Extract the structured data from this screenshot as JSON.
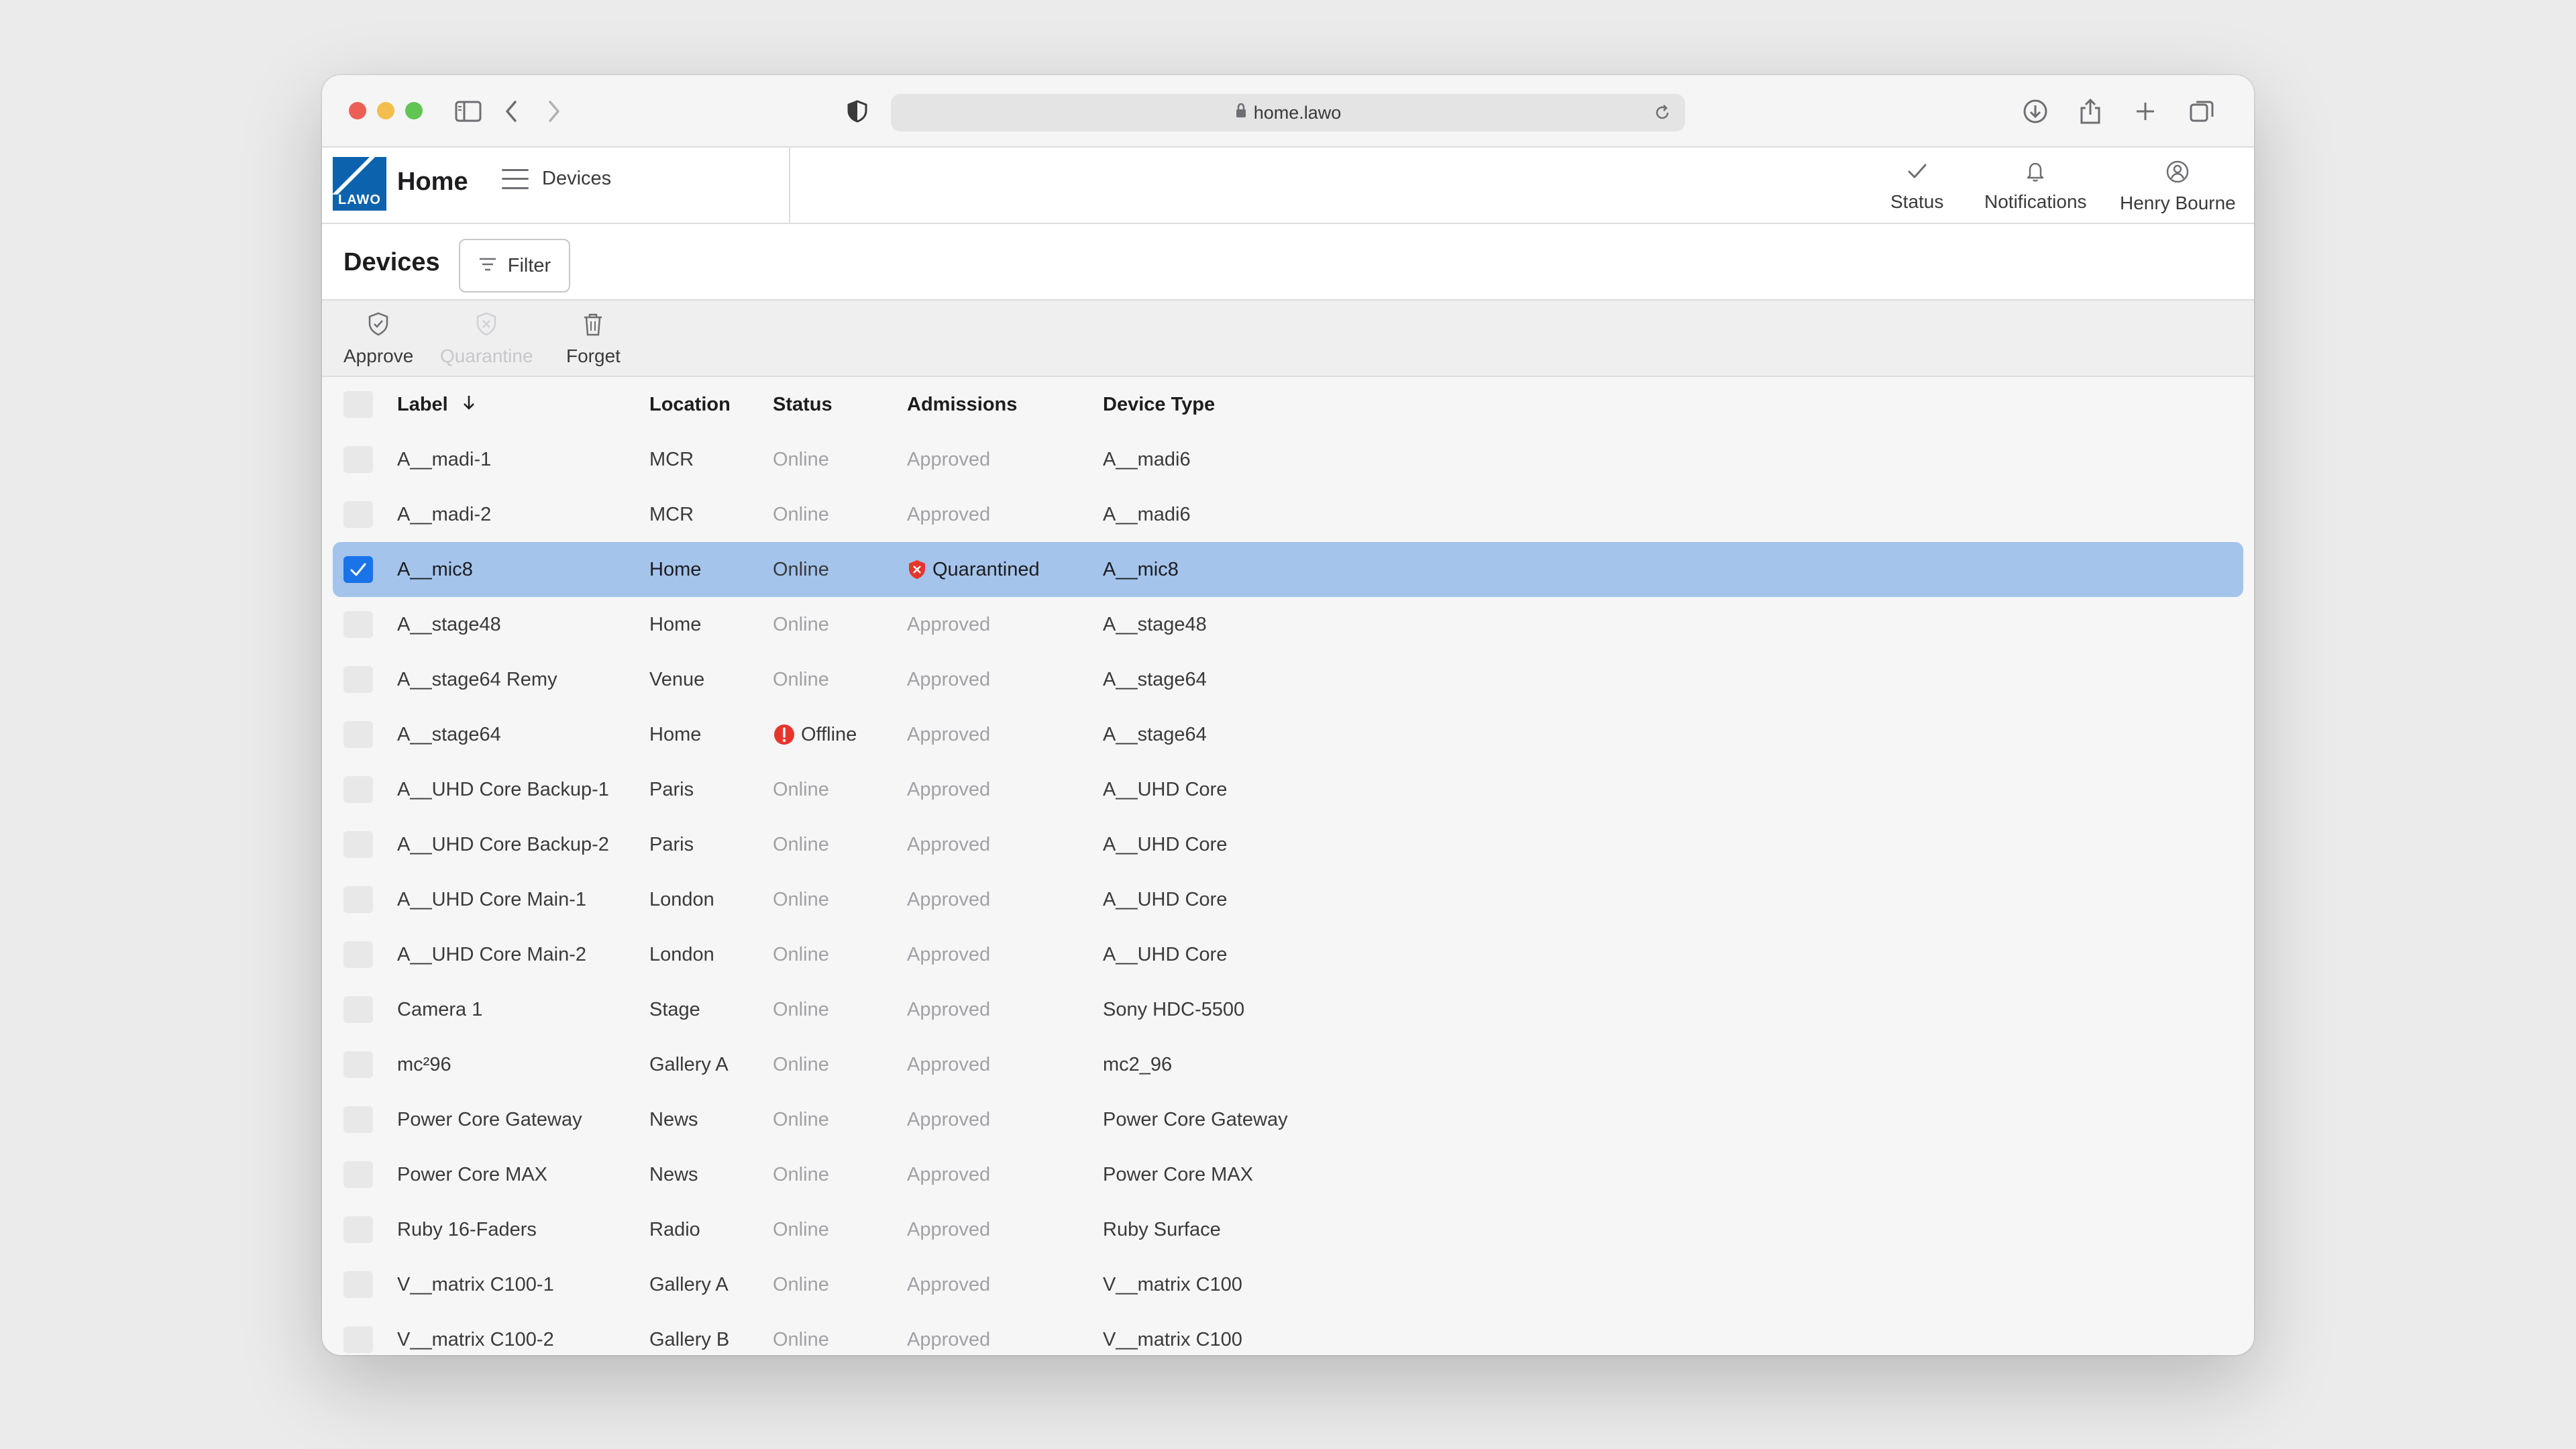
{
  "browser": {
    "url": "home.lawo"
  },
  "app": {
    "logo_text": "LAWO",
    "title": "Home",
    "menu_label": "Devices",
    "header_actions": {
      "status": "Status",
      "notifications": "Notifications",
      "user": "Henry Bourne"
    }
  },
  "page": {
    "title": "Devices",
    "filter_label": "Filter"
  },
  "actions": {
    "approve": "Approve",
    "quarantine": "Quarantine",
    "forget": "Forget"
  },
  "table": {
    "columns": {
      "label": "Label",
      "location": "Location",
      "status": "Status",
      "admissions": "Admissions",
      "device_type": "Device Type"
    },
    "rows": [
      {
        "label": "A__madi-1",
        "location": "MCR",
        "status": "Online",
        "admissions": "Approved",
        "device_type": "A__madi6"
      },
      {
        "label": "A__madi-2",
        "location": "MCR",
        "status": "Online",
        "admissions": "Approved",
        "device_type": "A__madi6"
      },
      {
        "label": "A__mic8",
        "location": "Home",
        "status": "Online",
        "admissions": "Quarantined",
        "device_type": "A__mic8"
      },
      {
        "label": "A__stage48",
        "location": "Home",
        "status": "Online",
        "admissions": "Approved",
        "device_type": "A__stage48"
      },
      {
        "label": "A__stage64 Remy",
        "location": "Venue",
        "status": "Online",
        "admissions": "Approved",
        "device_type": "A__stage64"
      },
      {
        "label": "A__stage64",
        "location": "Home",
        "status": "Offline",
        "admissions": "Approved",
        "device_type": "A__stage64"
      },
      {
        "label": "A__UHD Core Backup-1",
        "location": "Paris",
        "status": "Online",
        "admissions": "Approved",
        "device_type": "A__UHD Core"
      },
      {
        "label": "A__UHD Core Backup-2",
        "location": "Paris",
        "status": "Online",
        "admissions": "Approved",
        "device_type": "A__UHD Core"
      },
      {
        "label": "A__UHD Core Main-1",
        "location": "London",
        "status": "Online",
        "admissions": "Approved",
        "device_type": "A__UHD Core"
      },
      {
        "label": "A__UHD Core Main-2",
        "location": "London",
        "status": "Online",
        "admissions": "Approved",
        "device_type": "A__UHD Core"
      },
      {
        "label": "Camera 1",
        "location": "Stage",
        "status": "Online",
        "admissions": "Approved",
        "device_type": "Sony HDC-5500"
      },
      {
        "label": "mc²96",
        "location": "Gallery A",
        "status": "Online",
        "admissions": "Approved",
        "device_type": "mc2_96"
      },
      {
        "label": "Power Core Gateway",
        "location": "News",
        "status": "Online",
        "admissions": "Approved",
        "device_type": "Power Core Gateway"
      },
      {
        "label": "Power Core MAX",
        "location": "News",
        "status": "Online",
        "admissions": "Approved",
        "device_type": "Power Core MAX"
      },
      {
        "label": "Ruby 16-Faders",
        "location": "Radio",
        "status": "Online",
        "admissions": "Approved",
        "device_type": "Ruby Surface"
      },
      {
        "label": "V__matrix C100-1",
        "location": "Gallery A",
        "status": "Online",
        "admissions": "Approved",
        "device_type": "V__matrix C100"
      },
      {
        "label": "V__matrix C100-2",
        "location": "Gallery B",
        "status": "Online",
        "admissions": "Approved",
        "device_type": "V__matrix C100"
      }
    ]
  }
}
